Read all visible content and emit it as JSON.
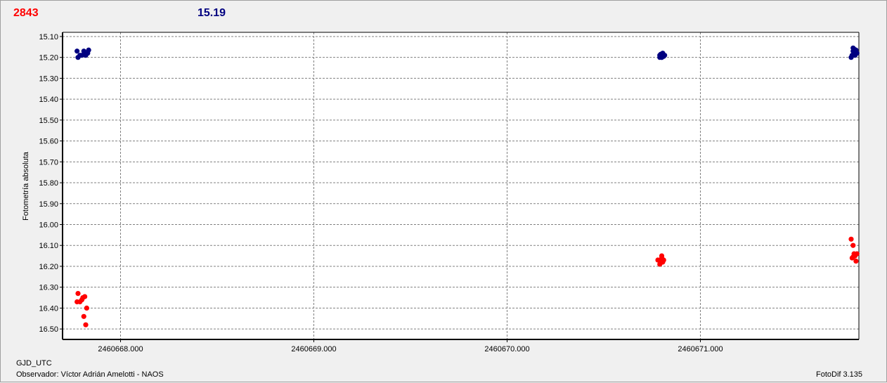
{
  "header": {
    "value_red": "2843",
    "value_blue": "15.19",
    "color_red": "#ff0000",
    "color_blue": "#000080"
  },
  "footer": {
    "x_name": "GJD_UTC",
    "observer": "Observador: Víctor Adrián Amelotti - NAOS",
    "software": "FotoDif 3.135"
  },
  "chart_data": {
    "type": "scatter",
    "title": "",
    "xlabel": "",
    "ylabel": "Fotometría absoluta",
    "y_inverted": true,
    "grid": true,
    "xlim": [
      2460667.7,
      2460671.82
    ],
    "ylim": [
      16.55,
      15.08
    ],
    "x_ticks": [
      "2460668.000",
      "2460669.000",
      "2460670.000",
      "2460671.000"
    ],
    "x_tick_values": [
      2460668.0,
      2460669.0,
      2460670.0,
      2460671.0
    ],
    "y_ticks": [
      "15.10",
      "15.20",
      "15.30",
      "15.40",
      "15.50",
      "15.60",
      "15.70",
      "15.80",
      "15.90",
      "16.00",
      "16.10",
      "16.20",
      "16.30",
      "16.40",
      "16.50"
    ],
    "y_tick_values": [
      15.1,
      15.2,
      15.3,
      15.4,
      15.5,
      15.6,
      15.7,
      15.8,
      15.9,
      16.0,
      16.1,
      16.2,
      16.3,
      16.4,
      16.5
    ],
    "series": [
      {
        "color": "#000080",
        "x": [
          2460667.775,
          2460667.78,
          2460667.79,
          2460667.8,
          2460667.81,
          2460667.815,
          2460667.82,
          2460667.83,
          2460667.835,
          2460670.79,
          2460670.795,
          2460670.8,
          2460670.805,
          2460670.81,
          2460670.815,
          2460670.8,
          2460670.79,
          2460671.78,
          2460671.785,
          2460671.79,
          2460671.795,
          2460671.8,
          2460671.805,
          2460671.81,
          2460671.79,
          2460671.8
        ],
        "y": [
          15.17,
          15.2,
          15.19,
          15.19,
          15.17,
          15.18,
          15.19,
          15.18,
          15.165,
          15.19,
          15.185,
          15.2,
          15.18,
          15.195,
          15.19,
          15.2,
          15.2,
          15.2,
          15.19,
          15.17,
          15.16,
          15.18,
          15.165,
          15.18,
          15.155,
          15.19
        ]
      },
      {
        "color": "#ff0000",
        "x": [
          2460667.775,
          2460667.78,
          2460667.79,
          2460667.8,
          2460667.805,
          2460667.81,
          2460667.815,
          2460667.82,
          2460667.825,
          2460670.78,
          2460670.79,
          2460670.795,
          2460670.8,
          2460670.805,
          2460670.81,
          2460670.8,
          2460671.78,
          2460671.785,
          2460671.79,
          2460671.795,
          2460671.8,
          2460671.805,
          2460671.81,
          2460671.79
        ],
        "y": [
          16.37,
          16.33,
          16.37,
          16.36,
          16.35,
          16.44,
          16.345,
          16.48,
          16.4,
          16.17,
          16.19,
          16.175,
          16.16,
          16.18,
          16.17,
          16.15,
          16.07,
          16.16,
          16.1,
          16.14,
          16.15,
          16.175,
          16.14,
          16.155
        ]
      }
    ]
  }
}
